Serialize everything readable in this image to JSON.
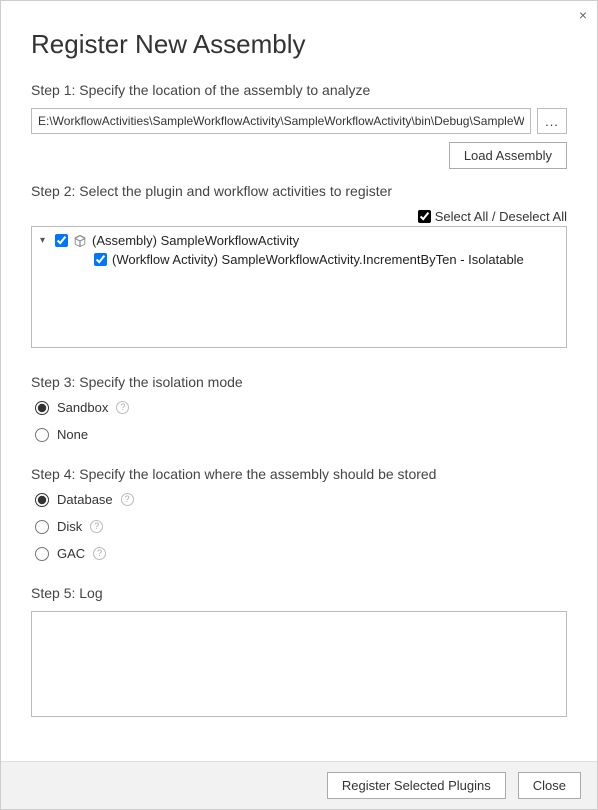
{
  "title": "Register New Assembly",
  "close_x": "×",
  "step1": {
    "label": "Step 1: Specify the location of the assembly to analyze",
    "path": "E:\\WorkflowActivities\\SampleWorkflowActivity\\SampleWorkflowActivity\\bin\\Debug\\SampleWo",
    "browse_label": "...",
    "load_label": "Load Assembly"
  },
  "step2": {
    "label": "Step 2: Select the plugin and workflow activities to register",
    "select_all_label": "Select All / Deselect All",
    "select_all_checked": true,
    "tree": {
      "assembly": {
        "checked": true,
        "label": "(Assembly) SampleWorkflowActivity"
      },
      "activity": {
        "checked": true,
        "label": "(Workflow Activity) SampleWorkflowActivity.IncrementByTen - Isolatable"
      }
    }
  },
  "step3": {
    "label": "Step 3: Specify the isolation mode",
    "options": {
      "sandbox": "Sandbox",
      "none": "None"
    },
    "selected": "sandbox"
  },
  "step4": {
    "label": "Step 4: Specify the location where the assembly should be stored",
    "options": {
      "database": "Database",
      "disk": "Disk",
      "gac": "GAC"
    },
    "selected": "database"
  },
  "step5": {
    "label": "Step 5: Log"
  },
  "footer": {
    "register_label": "Register Selected Plugins",
    "close_label": "Close"
  }
}
